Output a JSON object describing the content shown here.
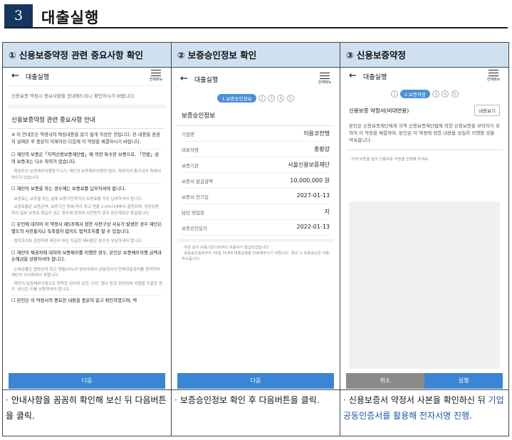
{
  "section": {
    "number": "3",
    "title": "대출실행"
  },
  "columns": [
    {
      "header": "① 신용보증약정 관련 중요사항 확인"
    },
    {
      "header": "② 보증승인정보 확인"
    },
    {
      "header": "③ 신용보증약정"
    }
  ],
  "phone": {
    "back": "←",
    "title": "대출실행",
    "menu_label": "전체메뉴"
  },
  "screen1": {
    "intro": "신용보증 약정시 중요사항을 안내해드리니 확인하시기 바랍니다.",
    "heading": "신용보증약정 관련 중요사항 안내",
    "p1": "※ 이 안내문은 약정서의 핵심내용을 알기 쉽게 작성한 것입니다. 본 내용을 꼼꼼히 살펴본 후 충분히 이해하신 다음에 이 약정을 체결하시기 바랍니다.",
    "p2": "☐ 재단의 보증은「지역신용보증재단법」에 의한 특수한 보증으로, 「민법」상의 보증과는 다소 차이가 있습니다.",
    "p2s": "· 재권자의 보증채무이행청구시기, 재단의 보증채무이행의 범위, 재권자의 통지의무 등에서 차이가 있습니다.",
    "p3": "☐ 재단이 보증을 하는 경우에는 보증료를 납부하셔야 합니다.",
    "p3s1": "· 보증료는 보증을 하는 날에 보증기한까지의 보증료를 미리 납부하셔야 합니다.",
    "p3s2": "· 보증료율은 보증금액, 보증기간 등에 따라 최고 연율 2.0%이내에서 결정되며, 정상상환하여 일부 보증료 환급이 있는 경우에 한하여 사전동지 없이 본인계좌로 환급됩니다.",
    "p4": "☐ 본인에 대하여 이 약정서 제5조에서 정한 사전구상 사유가 발생한 경우 재단은 별도의 사전통지나 독촉절차 없이도 법적조치를 할 수 있습니다.",
    "p4s": "· 법적조치와 관련하여 재단이 대신 지급한 제비용은 본인이 부담하셔야 합니다.",
    "p5": "☐ 재단이 채권자에 대하여 보증채무를 이행한 경우, 본인은 보증채무이행 금액과 손해금을 상환하셔야 합니다.",
    "p5s1": "· 손해금률은 법령상의 최고 연율20%의 범위내에서 금융회사의 연체대출금리를 참작하여 재단의 이사회에서 정합니다.",
    "p5s2": "· 재단이 보증채무이행으로 취득한 권리의 보전, 이전, 행사 등과 관련하여 비용을 지출한 경우, 본인은 이를 상환하셔야 합니다.",
    "p6": "☐ 본인은 이 약정서의 중요한 내용을 충분히 읽고 확인하였으며, 약",
    "next": "다음"
  },
  "screen2": {
    "step_active": "1.보증승인정보",
    "steps_rest": [
      "2",
      "3",
      "4",
      "5"
    ],
    "title": "보증승인정보",
    "rows": [
      {
        "k": "기업명",
        "v": "이용코전맹"
      },
      {
        "k": "대표자명",
        "v": "총팡강"
      },
      {
        "k": "보증기관",
        "v": "서울신용보증재단"
      },
      {
        "k": "보증서 발급금액",
        "v": "10,000,000 원"
      },
      {
        "k": "보증서 만기일",
        "v": "2027-01-13"
      },
      {
        "k": "담당 영업점",
        "v": "지"
      },
      {
        "k": "보증승인일자",
        "v": "2022-01-13"
      }
    ],
    "note1": "· 위와 같이 보증기관으로부터 보증서가 발급되었습니다.",
    "note2": "· 보증승인일로부터 30일 이내에 대출실행을 완료해주시기 바랍니다. 경과 시 보증승인은 자동 취소됩니다.",
    "next": "다음"
  },
  "screen3": {
    "step_active": "2.보증약정",
    "steps_before": [
      "1"
    ],
    "steps_after": [
      "3",
      "4",
      "5"
    ],
    "doc_title": "신용보증 약정서(비대면용)",
    "view_button": "내용보기",
    "desc": "본인은 신용보증재단에게 지역 신용보증재단법에 의한 신용보증을 부탁하기 위하여 이 약정을 체결하며, 본인은 이 약정에 정한 내용을 성실히 이행할 것을 약속합니다.",
    "hint": "· 아래 버튼을 눌러 신용보증 약정을 진행해 주세요.",
    "cancel": "취소",
    "execute": "실행"
  },
  "notes": {
    "n1": "안내사항을 꼼꼼히 확인해 보신 뒤 다음버튼을 클릭.",
    "n2": "보증승인정보 확인 후 다음버튼을 클릭.",
    "n3a": "신용보증서 약정서 사본을 확인하신 뒤 ",
    "n3b": "기업공동인증서를 활용해 전자서명 진행",
    "n3c": "."
  },
  "colors": {
    "header_bg": "#cfe0f1",
    "section_num_bg": "#16365f",
    "accent_blue": "#3a86d4",
    "link_blue": "#1a56a8"
  }
}
